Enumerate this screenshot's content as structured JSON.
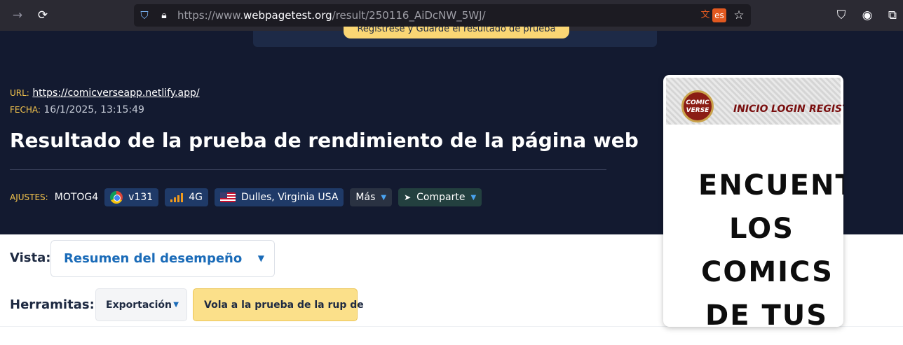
{
  "browser": {
    "url_prefix": "https://www.",
    "url_host": "webpagetest.org",
    "url_path": "/result/250116_AiDcNW_5WJ/",
    "translate_lang": "es",
    "icons": [
      "back-icon",
      "reload-icon",
      "shield-icon",
      "lock-icon",
      "translate-icon",
      "star-icon",
      "pocket-icon",
      "account-icon",
      "extensions-icon"
    ]
  },
  "banner": {
    "button_label": "Regístrese y Guarde el resultado de prueba"
  },
  "meta": {
    "url_label": "URL:",
    "url_value": "https://comicverseapp.netlify.app/",
    "date_label": "FECHA:",
    "date_value": "16/1/2025, 13:15:49"
  },
  "title": "Resultado de la prueba de rendimiento de la página web",
  "settings": {
    "label": "AJUSTES:",
    "device": "MOTOG4",
    "browser_version": "v131",
    "connection": "4G",
    "location": "Dulles, Virginia USA",
    "more": "Más",
    "share": "Comparte"
  },
  "view": {
    "label": "Vista:",
    "selected": "Resumen del desempeño"
  },
  "tools": {
    "label": "Herramitas:",
    "export": "Exportación",
    "retest": "Vola a la prueba de la rup de"
  },
  "preview": {
    "logo_line1": "COMIC",
    "logo_line2": "VERSE",
    "nav": [
      "INICIO",
      "LOGIN",
      "REGISTRO"
    ],
    "hero_lines": [
      "ENCUENTRA",
      "LOS",
      "COMICS",
      "DE TUS"
    ]
  },
  "colors": {
    "header_bg": "#131a30",
    "accent_yellow": "#fad674",
    "link_blue": "#1a6bb8",
    "label_gold": "#f5c54d"
  }
}
